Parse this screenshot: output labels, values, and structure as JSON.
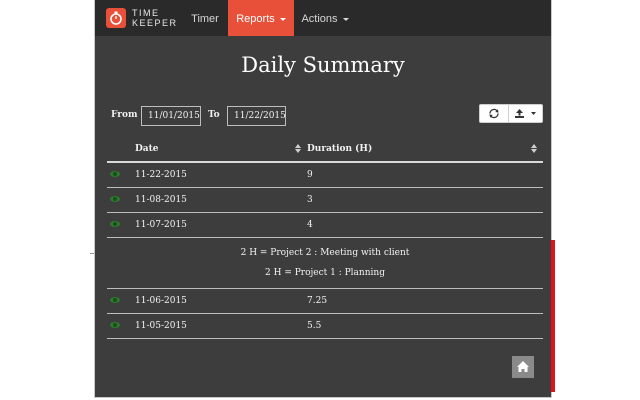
{
  "brand": {
    "line1": "TIME",
    "line2": "KEEPER"
  },
  "nav": [
    {
      "label": "Timer"
    },
    {
      "label": "Reports"
    },
    {
      "label": "Actions"
    }
  ],
  "page_title": "Daily Summary",
  "filters": {
    "from_label": "From",
    "from_value": "11/01/2015",
    "to_label": "To",
    "to_value": "11/22/2015"
  },
  "table": {
    "columns": [
      "Date",
      "Duration (H)"
    ],
    "rows": [
      {
        "date": "11-22-2015",
        "duration": "9"
      },
      {
        "date": "11-08-2015",
        "duration": "3"
      },
      {
        "date": "11-07-2015",
        "duration": "4"
      },
      {
        "date": "11-06-2015",
        "duration": "7.25"
      },
      {
        "date": "11-05-2015",
        "duration": "5.5"
      }
    ],
    "expanded_detail": [
      "2 H =   Project 2 :   Meeting with client",
      "2 H =   Project 1 :   Planning"
    ]
  },
  "colors": {
    "accent": "#e8503a",
    "background": "#3d3d3d",
    "navbar": "#2a2a2a",
    "eye_icon": "#2c7a2c"
  }
}
